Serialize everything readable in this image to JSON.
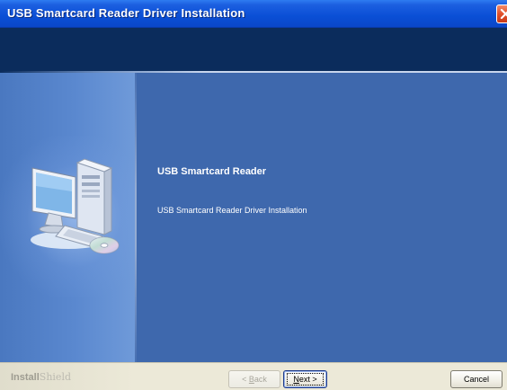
{
  "window": {
    "title": "USB Smartcard Reader Driver Installation"
  },
  "main": {
    "heading": "USB Smartcard Reader",
    "subtext": "USB Smartcard Reader Driver Installation"
  },
  "footer": {
    "brand_strong": "Install",
    "brand_light": "Shield",
    "buttons": {
      "back_prefix": "< ",
      "back_hotkey": "B",
      "back_rest": "ack",
      "next_hotkey": "N",
      "next_rest": "ext >",
      "cancel": "Cancel"
    }
  },
  "icons": {
    "close": "close-icon",
    "computer": "computer-with-cd-icon"
  },
  "colors": {
    "titlebar": "#0a4fd6",
    "header_band": "#0b2c5c",
    "main_bg": "#3e68ad",
    "left_panel": "#5a88cf",
    "footer": "#ece9d8",
    "close_button": "#e0502a"
  }
}
